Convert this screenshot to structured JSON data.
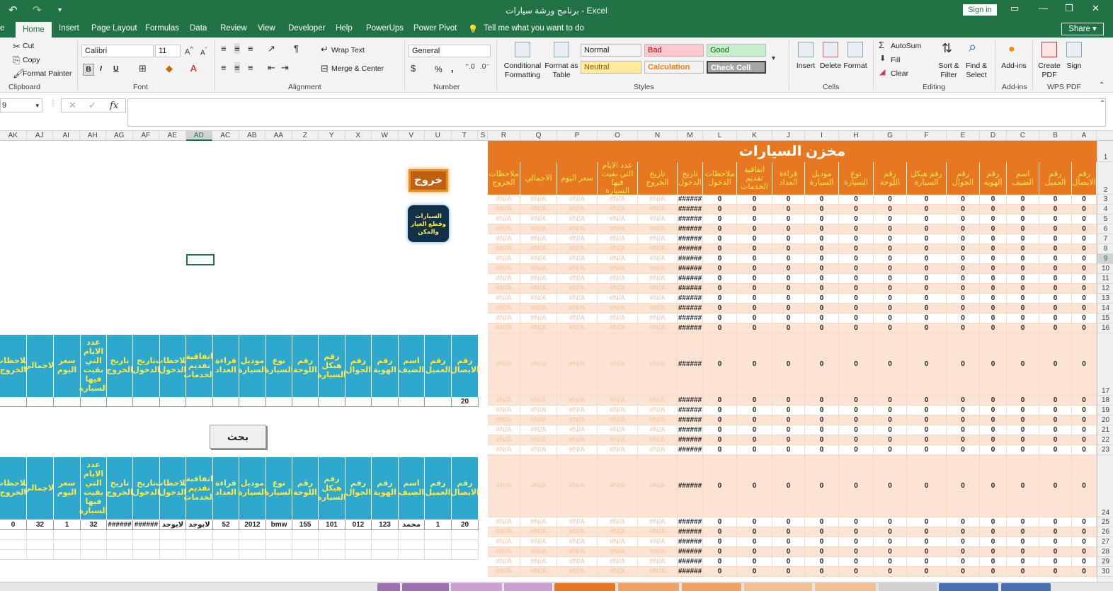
{
  "window": {
    "title": "برنامج ورشة سيارات  -  Excel",
    "signin": "Sign in",
    "share": "Share"
  },
  "ribbon_tabs": [
    {
      "label": "e"
    },
    {
      "label": "Home"
    },
    {
      "label": "Insert"
    },
    {
      "label": "Page Layout"
    },
    {
      "label": "Formulas"
    },
    {
      "label": "Data"
    },
    {
      "label": "Review"
    },
    {
      "label": "View"
    },
    {
      "label": "Developer"
    },
    {
      "label": "Help"
    },
    {
      "label": "PowerUps"
    },
    {
      "label": "Power Pivot"
    },
    {
      "label": "Tell me what you want to do"
    }
  ],
  "clipboard": {
    "cut": "Cut",
    "copy": "Copy",
    "format_painter": "Format Painter",
    "label": "Clipboard"
  },
  "font": {
    "name": "Calibri",
    "size": "11",
    "label": "Font",
    "bold": "B",
    "italic": "I",
    "underline": "U"
  },
  "alignment": {
    "wrap": "Wrap Text",
    "merge": "Merge & Center",
    "label": "Alignment"
  },
  "number": {
    "format": "General",
    "label": "Number",
    "percent": "%",
    "comma": ","
  },
  "styles": {
    "label": "Styles",
    "conditional": "Conditional Formatting",
    "format_table": "Format as Table",
    "cells": [
      {
        "label": "Normal",
        "bg": "#ffffff",
        "fg": "#000000"
      },
      {
        "label": "Bad",
        "bg": "#ffc7ce",
        "fg": "#9c0006"
      },
      {
        "label": "Good",
        "bg": "#c6efce",
        "fg": "#006100"
      },
      {
        "label": "Neutral",
        "bg": "#ffeb9c",
        "fg": "#9c5700"
      },
      {
        "label": "Calculation",
        "bg": "#f2f2f2",
        "fg": "#fa7d00"
      },
      {
        "label": "Check Cell",
        "bg": "#a5a5a5",
        "fg": "#ffffff"
      }
    ]
  },
  "cells_group": {
    "insert": "Insert",
    "delete": "Delete",
    "format": "Format",
    "label": "Cells"
  },
  "editing": {
    "autosum": "AutoSum",
    "fill": "Fill",
    "clear": "Clear",
    "sort": "Sort & Filter",
    "find": "Find & Select",
    "label": "Editing"
  },
  "addins": {
    "btn": "Add-ins",
    "label": "Add-ins"
  },
  "wps": {
    "create": "Create PDF",
    "sign": "Sign",
    "label": "WPS PDF"
  },
  "formula_bar": {
    "namebox": "9",
    "fx": "fx"
  },
  "columns_left": [
    "AK",
    "AJ",
    "AI",
    "AH",
    "AG",
    "AF",
    "AE",
    "AD",
    "AC",
    "AB",
    "AA",
    "Z",
    "Y",
    "X",
    "W",
    "V",
    "U",
    "T",
    "S"
  ],
  "columns_right": [
    "R",
    "Q",
    "P",
    "O",
    "N",
    "M",
    "L",
    "K",
    "J",
    "I",
    "H",
    "G",
    "F",
    "E",
    "D",
    "C",
    "B",
    "A"
  ],
  "rows": [
    "1",
    "2",
    "3",
    "4",
    "5",
    "6",
    "7",
    "8",
    "9",
    "10",
    "11",
    "12",
    "13",
    "14",
    "15",
    "16",
    "17",
    "18",
    "19",
    "20",
    "21",
    "22",
    "23",
    "24",
    "25",
    "26",
    "27",
    "28",
    "29",
    "30"
  ],
  "right_table": {
    "title": "مخزن السيارات",
    "headers": [
      "ملاحظات الخروج",
      "الاجمالي",
      "سعر اليوم",
      "عدد الايام التي بقيت فيها السيارة",
      "تاريخ الخروج",
      "تاريخ الدخول",
      "ملاحظات الدخول",
      "اتفاقية تقديم الخدمات",
      "قراءة العداد",
      "موديل السيارة",
      "نوع السيارة",
      "رقم اللوحة",
      "رقم هيكل السيارة",
      "رقم الجوال",
      "رقم الهوية",
      "اسم الضيف",
      "رقم العميل",
      "رقم الايصال"
    ],
    "na_value": "#N/A",
    "hash_value": "######",
    "zero_value": "0"
  },
  "buttons": {
    "exit": "خروج",
    "cars": "السيارات وقطع الغيار والمكن",
    "search": "بحث"
  },
  "left_table1": {
    "headers": [
      "ملاحظات الخروج",
      "الاجمالي",
      "سعر اليوم",
      "عدد الايام التي بقيت فيها السيارة",
      "تاريخ الخروج",
      "تاريخ الدخول",
      "ملاحظات الدخول",
      "اتفاقية تقديم الخدمات",
      "قراءة العداد",
      "موديل السيارة",
      "نوع السيارة",
      "رقم اللوحة",
      "رقم هيكل السيارة",
      "رقم الجوال",
      "رقم الهوية",
      "اسم الضيف",
      "رقم العميل",
      "رقم الايصال"
    ],
    "row": [
      "",
      "",
      "",
      "",
      "",
      "",
      "",
      "",
      "",
      "",
      "",
      "",
      "",
      "",
      "",
      "",
      "",
      "20"
    ]
  },
  "left_table2": {
    "headers": [
      "ملاحظات الخروج",
      "الاجمالي",
      "سعر اليوم",
      "عدد الايام التي بقيت فيها السيارة",
      "تاريخ الخروج",
      "تاريخ الدخول",
      "ملاحظات الدخول",
      "اتفاقية تقديم الخدمات",
      "قراءة العداد",
      "موديل السيارة",
      "نوع السيارة",
      "رقم اللوحة",
      "رقم هيكل السيارة",
      "رقم الجوال",
      "رقم الهوية",
      "اسم الضيف",
      "رقم العميل",
      "رقم الايصال"
    ],
    "row": [
      "0",
      "32",
      "1",
      "32",
      "######",
      "######",
      "لايوجد",
      "لايوجد",
      "52",
      "2012",
      "bmw",
      "155",
      "101",
      "012",
      "123",
      "محمد",
      "1",
      "20"
    ]
  },
  "sheet_tabs": [
    {
      "color": "#9b6fb0"
    },
    {
      "color": "#9b6fb0"
    },
    {
      "color": "#c9a0d0"
    },
    {
      "color": "#c9a0d0"
    },
    {
      "color": "#e87722"
    },
    {
      "color": "#f0a060"
    },
    {
      "color": "#f0a060"
    },
    {
      "color": "#f0c090"
    },
    {
      "color": "#f0c090"
    },
    {
      "color": "#d0d0d0"
    },
    {
      "color": "#4a6fb0"
    },
    {
      "color": "#4a6fb0"
    }
  ]
}
